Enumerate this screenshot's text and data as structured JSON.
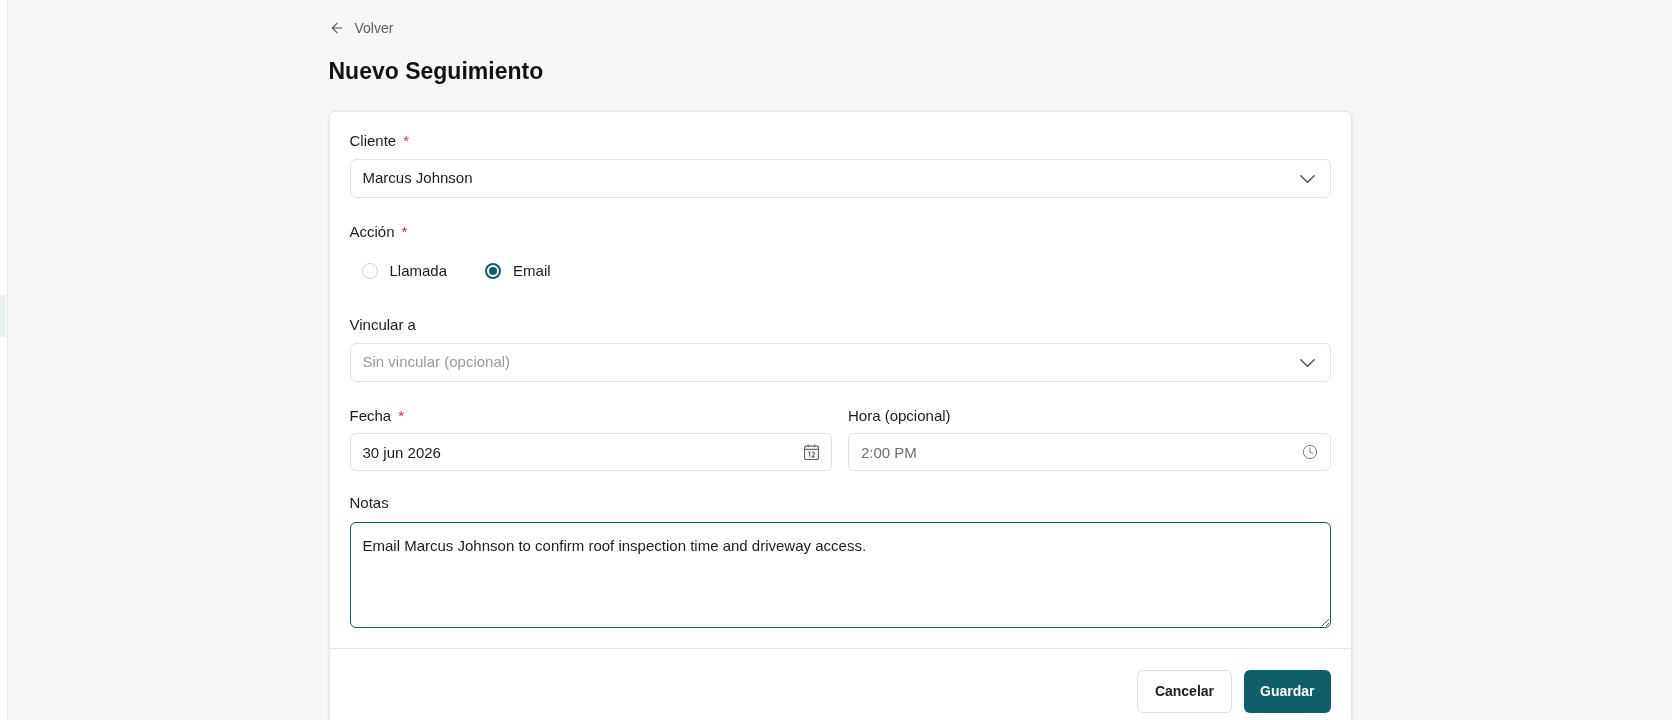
{
  "back_link": {
    "label": "Volver"
  },
  "title": "Nuevo Seguimiento",
  "form": {
    "fields": [
      {
        "kind": "select",
        "label": "Cliente",
        "required_mark": "*",
        "value": "Marcus Johnson"
      },
      {
        "kind": "radio",
        "label": "Acción",
        "required_mark": "*",
        "options": [
          {
            "label": "Llamada",
            "selected": false
          },
          {
            "label": "Email",
            "selected": true
          }
        ]
      },
      {
        "kind": "select",
        "label": "Vincular a",
        "placeholder": "Sin vincular (opcional)"
      },
      {
        "kind": "row",
        "fields": [
          {
            "kind": "date",
            "label": "Fecha",
            "required_mark": "*",
            "value": "30 jun 2026"
          },
          {
            "kind": "time",
            "label": "Hora (opcional)",
            "placeholder": "2:00 PM"
          }
        ]
      },
      {
        "kind": "textarea",
        "label": "Notas",
        "value": "Email Marcus Johnson to confirm roof inspection time and driveway access.",
        "focused": true
      }
    ],
    "buttons": [
      {
        "kind": "secondary",
        "label": "Cancelar"
      },
      {
        "kind": "primary",
        "label": "Guardar"
      }
    ]
  }
}
